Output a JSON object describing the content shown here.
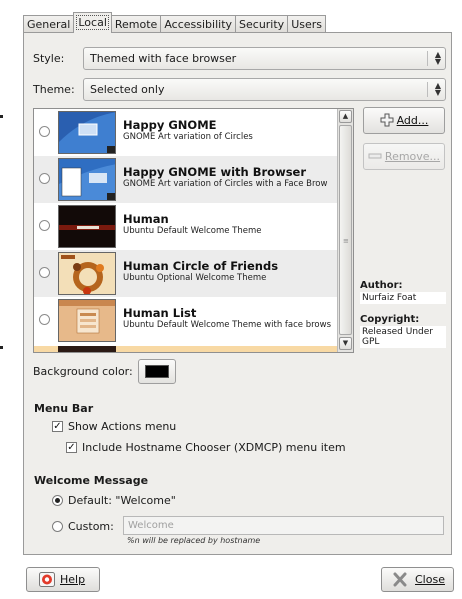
{
  "tabs": [
    {
      "label": "General",
      "active": false
    },
    {
      "label": "Local",
      "active": true
    },
    {
      "label": "Remote",
      "active": false
    },
    {
      "label": "Accessibility",
      "active": false
    },
    {
      "label": "Security",
      "active": false
    },
    {
      "label": "Users",
      "active": false
    }
  ],
  "style": {
    "label": "Style:",
    "value": "Themed with face browser"
  },
  "theme": {
    "label": "Theme:",
    "value": "Selected only"
  },
  "theme_list": [
    {
      "name": "Happy GNOME",
      "description": "GNOME Art variation of Circles"
    },
    {
      "name": "Happy GNOME with Browser",
      "description": "GNOME Art variation of Circles with a Face Brow"
    },
    {
      "name": "Human",
      "description": "Ubuntu Default Welcome Theme"
    },
    {
      "name": "Human Circle of Friends",
      "description": "Ubuntu Optional Welcome Theme"
    },
    {
      "name": "Human List",
      "description": "Ubuntu Default Welcome Theme with face brows"
    }
  ],
  "buttons": {
    "add": "Add...",
    "remove": "Remove...",
    "help": "Help",
    "close": "Close"
  },
  "author": {
    "label": "Author:",
    "value": "Nurfaiz Foat"
  },
  "copyright": {
    "label": "Copyright:",
    "value_line1": "Released Under",
    "value_line2": "GPL"
  },
  "background_color": {
    "label": "Background color:",
    "value": "#000000"
  },
  "menu_bar": {
    "title": "Menu Bar",
    "show_actions": {
      "label": "Show Actions menu",
      "checked": true
    },
    "include_hostname": {
      "label": "Include Hostname Chooser (XDMCP) menu item",
      "checked": true
    }
  },
  "welcome": {
    "title": "Welcome Message",
    "default_label": "Default: \"Welcome\"",
    "default_selected": true,
    "custom_label": "Custom:",
    "custom_value": "Welcome",
    "hint": "%n will be replaced by hostname"
  },
  "icons": {
    "add": "plus-icon",
    "remove": "minus-icon",
    "help": "lifebuoy-icon",
    "close": "close-x-icon",
    "scroll_up": "arrow-up-icon",
    "scroll_down": "arrow-down-icon",
    "combo": "updown-arrows-icon"
  }
}
